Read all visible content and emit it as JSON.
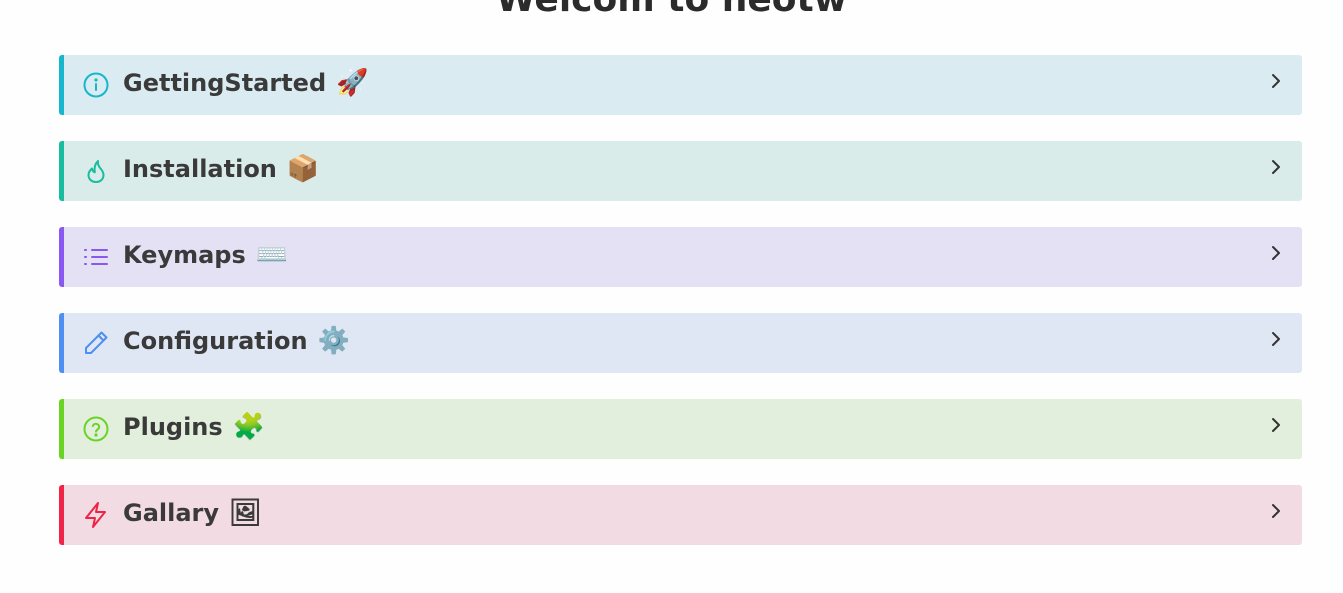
{
  "page": {
    "title": "Welcom to neotw"
  },
  "callouts": [
    {
      "label": "GettingStarted",
      "emoji": "🚀",
      "icon": "info-icon",
      "emoji_name": "rocket-emoji",
      "accent": "#16b6cc",
      "background": "#daecf1"
    },
    {
      "label": "Installation",
      "emoji": "📦",
      "icon": "flame-icon",
      "emoji_name": "package-emoji",
      "accent": "#18bda0",
      "background": "#d9ece9"
    },
    {
      "label": "Keymaps",
      "emoji": "⌨️",
      "icon": "list-icon",
      "emoji_name": "keyboard-emoji",
      "accent": "#8b57f2",
      "background": "#e5e1f5"
    },
    {
      "label": "Configuration",
      "emoji": "⚙️",
      "icon": "pencil-icon",
      "emoji_name": "gear-emoji",
      "accent": "#4e8ff2",
      "background": "#e0e7f4"
    },
    {
      "label": "Plugins",
      "emoji": "🧩",
      "icon": "question-icon",
      "emoji_name": "puzzle-emoji",
      "accent": "#6ad425",
      "background": "#e3efdd"
    },
    {
      "label": "Gallary",
      "emoji": "🖼",
      "icon": "lightning-icon",
      "emoji_name": "picture-emoji",
      "accent": "#f02446",
      "background": "#f2dbe2"
    }
  ],
  "chevron_icon": "chevron-right-icon"
}
